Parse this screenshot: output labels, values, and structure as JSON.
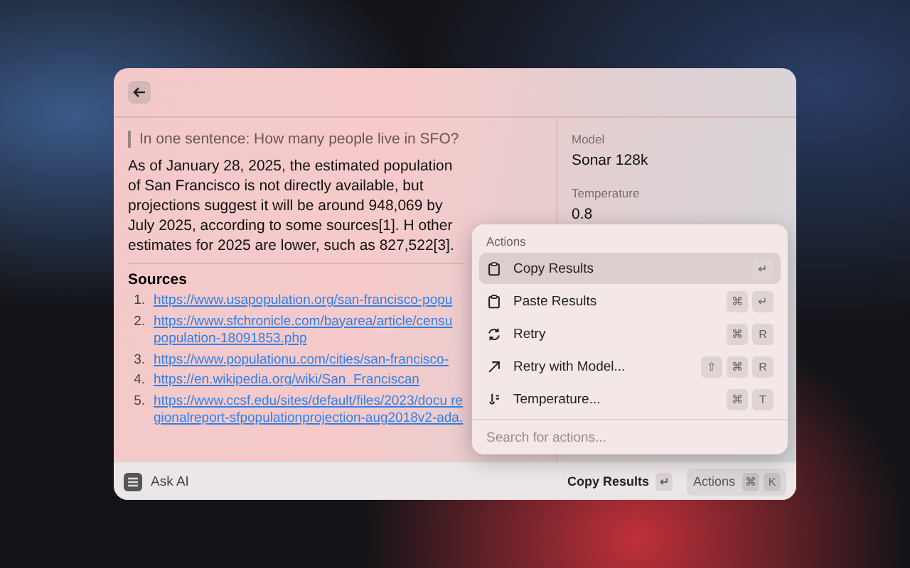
{
  "question": "In one sentence: How many people live in SFO?",
  "answer": "As of January 28, 2025, the estimated population of San Francisco is not directly available, but projections suggest it will be around 948,069 by July 2025, according to some sources[1]. H other estimates for 2025 are lower, such as 827,522[3].",
  "sources": {
    "title": "Sources",
    "items": [
      {
        "number": "1.",
        "url": "https://www.usapopulation.org/san-francisco-popu"
      },
      {
        "number": "2.",
        "url": "https://www.sfchronicle.com/bayarea/article/censu population-18091853.php"
      },
      {
        "number": "3.",
        "url": "https://www.populationu.com/cities/san-francisco-"
      },
      {
        "number": "4.",
        "url": "https://en.wikipedia.org/wiki/San_Franciscan"
      },
      {
        "number": "5.",
        "url": "https://www.ccsf.edu/sites/default/files/2023/docu regionalreport-sfpopulationprojection-aug2018v2-ada."
      }
    ]
  },
  "details": [
    {
      "label": "Model",
      "value": "Sonar 128k"
    },
    {
      "label": "Temperature",
      "value": "0.8"
    }
  ],
  "actions_menu": {
    "title": "Actions",
    "items": [
      {
        "label": "Copy Results",
        "keys": [
          "↵"
        ],
        "selected": true
      },
      {
        "label": "Paste Results",
        "keys": [
          "⌘",
          "↵"
        ],
        "selected": false
      },
      {
        "label": "Retry",
        "keys": [
          "⌘",
          "R"
        ],
        "selected": false
      },
      {
        "label": "Retry with Model...",
        "keys": [
          "⇧",
          "⌘",
          "R"
        ],
        "selected": false
      },
      {
        "label": "Temperature...",
        "keys": [
          "⌘",
          "T"
        ],
        "selected": false
      }
    ],
    "search": {
      "placeholder": "Search for actions..."
    }
  },
  "footer": {
    "title": "Ask AI",
    "primary_action": {
      "label": "Copy Results",
      "keys": [
        "↵"
      ]
    },
    "actions": {
      "label": "Actions",
      "keys": [
        "⌘",
        "K"
      ]
    }
  }
}
